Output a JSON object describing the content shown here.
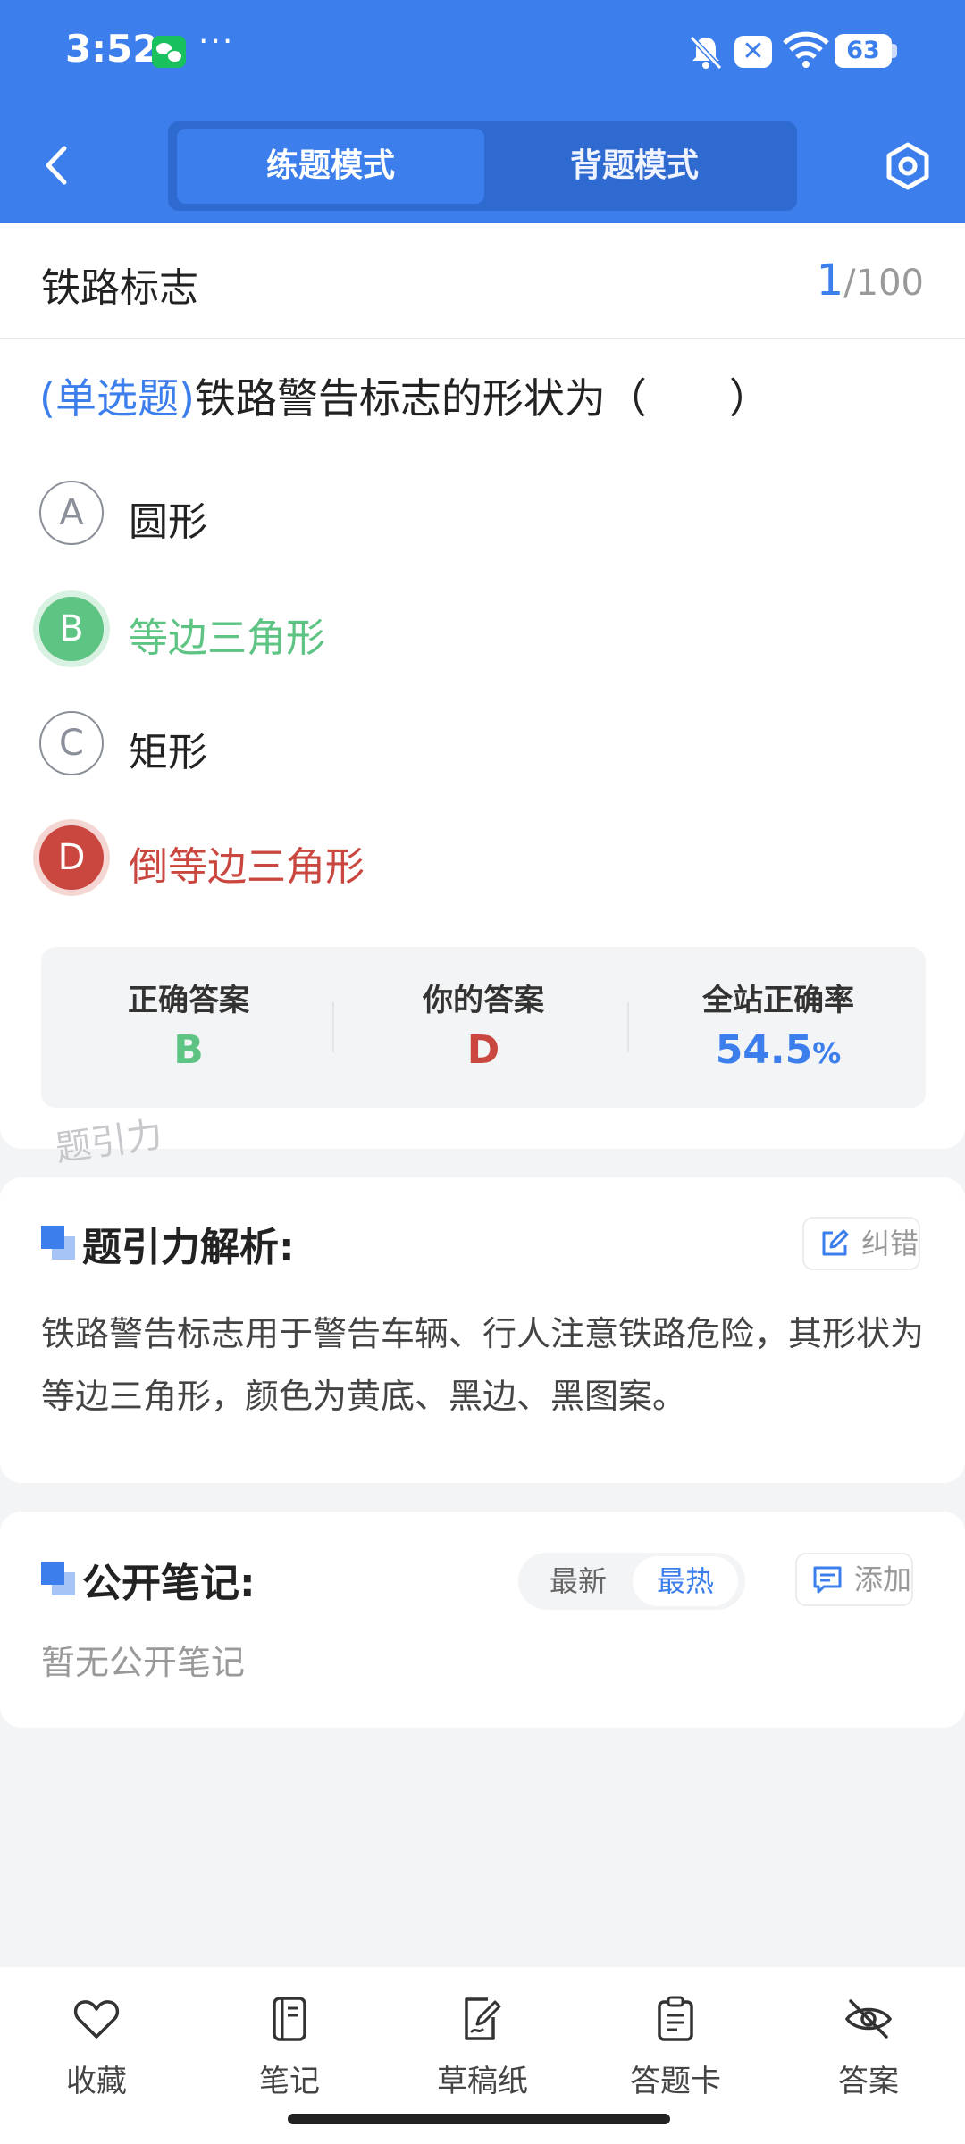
{
  "status_bar": {
    "time": "3:52",
    "more": "···",
    "notification": "✕",
    "battery": "63"
  },
  "header": {
    "tabs": [
      "练题模式",
      "背题模式"
    ],
    "active_tab": "练题模式",
    "accent_color": "#3d7eed"
  },
  "question_card": {
    "category": "铁路标志",
    "current": "1",
    "total": "/100",
    "qtype": "(单选题)",
    "question": "铁路警告标志的形状为（　　）",
    "options": [
      {
        "letter": "A",
        "text": "圆形",
        "state": "normal"
      },
      {
        "letter": "B",
        "text": "等边三角形",
        "state": "correct"
      },
      {
        "letter": "C",
        "text": "矩形",
        "state": "normal"
      },
      {
        "letter": "D",
        "text": "倒等边三角形",
        "state": "wrong"
      }
    ],
    "stats": {
      "correct_label": "正确答案",
      "correct_value": "B",
      "yours_label": "你的答案",
      "yours_value": "D",
      "rate_label": "全站正确率",
      "rate_value": "54.5",
      "rate_unit": "%"
    },
    "watermark": "题引力",
    "colors": {
      "correct": "#5ec483",
      "wrong": "#c9473f"
    }
  },
  "analysis": {
    "title": "题引力解析:",
    "report_button": "纠错",
    "text": "铁路警告标志用于警告车辆、行人注意铁路危险，其形状为等边三角形，颜色为黄底、黑边、黑图案。"
  },
  "notes": {
    "title": "公开笔记:",
    "sort_options": [
      "最新",
      "最热"
    ],
    "active_sort": "最热",
    "add_button": "添加",
    "empty_text": "暂无公开笔记"
  },
  "bottom_bar": {
    "items": [
      {
        "label": "收藏",
        "icon": "heart-icon"
      },
      {
        "label": "笔记",
        "icon": "notebook-icon"
      },
      {
        "label": "草稿纸",
        "icon": "draft-pen-icon"
      },
      {
        "label": "答题卡",
        "icon": "clipboard-icon"
      },
      {
        "label": "答案",
        "icon": "eye-off-icon"
      }
    ]
  }
}
